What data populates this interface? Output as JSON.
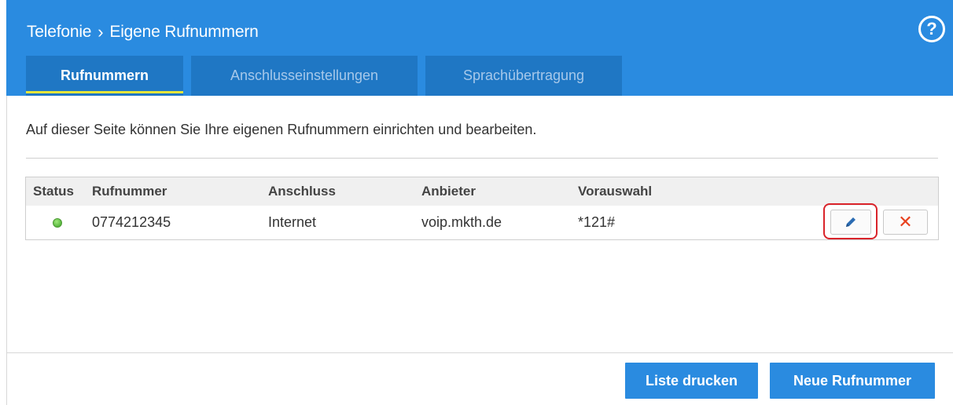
{
  "header": {
    "breadcrumb": [
      "Telefonie",
      "Eigene Rufnummern"
    ],
    "separator": "›",
    "help": "?",
    "tabs": [
      {
        "label": "Rufnummern",
        "active": true
      },
      {
        "label": "Anschlusseinstellungen",
        "active": false
      },
      {
        "label": "Sprachübertragung",
        "active": false
      }
    ]
  },
  "main": {
    "intro": "Auf dieser Seite können Sie Ihre eigenen Rufnummern einrichten und bearbeiten.",
    "table": {
      "columns": [
        "Status",
        "Rufnummer",
        "Anschluss",
        "Anbieter",
        "Vorauswahl"
      ],
      "rows": [
        {
          "status": "online",
          "number": "0774212345",
          "connection": "Internet",
          "provider": "voip.mkth.de",
          "preselection": "*121#"
        }
      ]
    },
    "delete_symbol": "✕"
  },
  "footer": {
    "print_label": "Liste drucken",
    "new_label": "Neue Rufnummer"
  },
  "colors": {
    "accent": "#2a8be0",
    "tab_bg": "#1f77c4",
    "tab_underline": "#e5e53a",
    "status_online": "#5bc33a",
    "delete": "#e8401d",
    "highlight": "#d9232a"
  }
}
